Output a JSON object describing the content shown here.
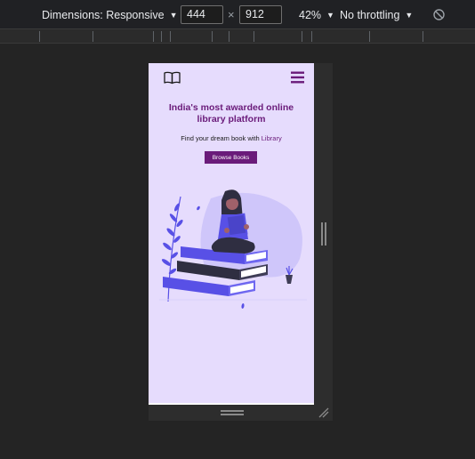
{
  "devtools": {
    "dimensions_label": "Dimensions: Responsive",
    "width_value": "444",
    "height_value": "912",
    "times_sign": "×",
    "zoom": "42%",
    "throttling": "No throttling"
  },
  "page": {
    "headline": "India's most awarded online library platform",
    "subline_prefix": "Find your dream book with",
    "subline_highlight": "Library",
    "browse_button": "Browse Books"
  },
  "colors": {
    "page_background": "#e6dcfd",
    "brand": "#6a1b7a",
    "book_accent": "#5850e6"
  },
  "icons": {
    "logo": "open-book-icon",
    "menu": "hamburger-menu-icon",
    "rotate": "rotate-icon"
  }
}
